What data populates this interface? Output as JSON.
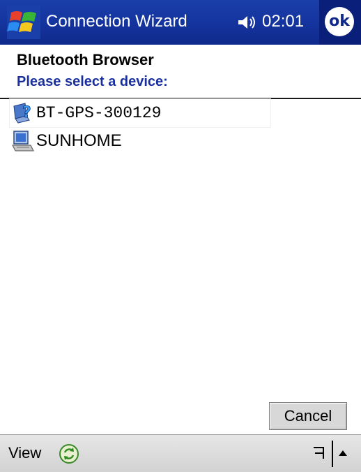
{
  "titlebar": {
    "title": "Connection Wizard",
    "clock": "02:01",
    "ok_label": "ok"
  },
  "header": {
    "title": "Bluetooth Browser",
    "subtitle": "Please select a device:"
  },
  "devices": [
    {
      "label": "BT-GPS-300129",
      "icon": "unknown-device-icon",
      "selected": true
    },
    {
      "label": "SUNHOME",
      "icon": "computer-icon",
      "selected": false
    }
  ],
  "buttons": {
    "cancel": "Cancel"
  },
  "menubar": {
    "view": "View"
  },
  "colors": {
    "titlebar": "#1535a0",
    "subtitle": "#1a2f9e",
    "menubar": "#d8d8d8"
  }
}
